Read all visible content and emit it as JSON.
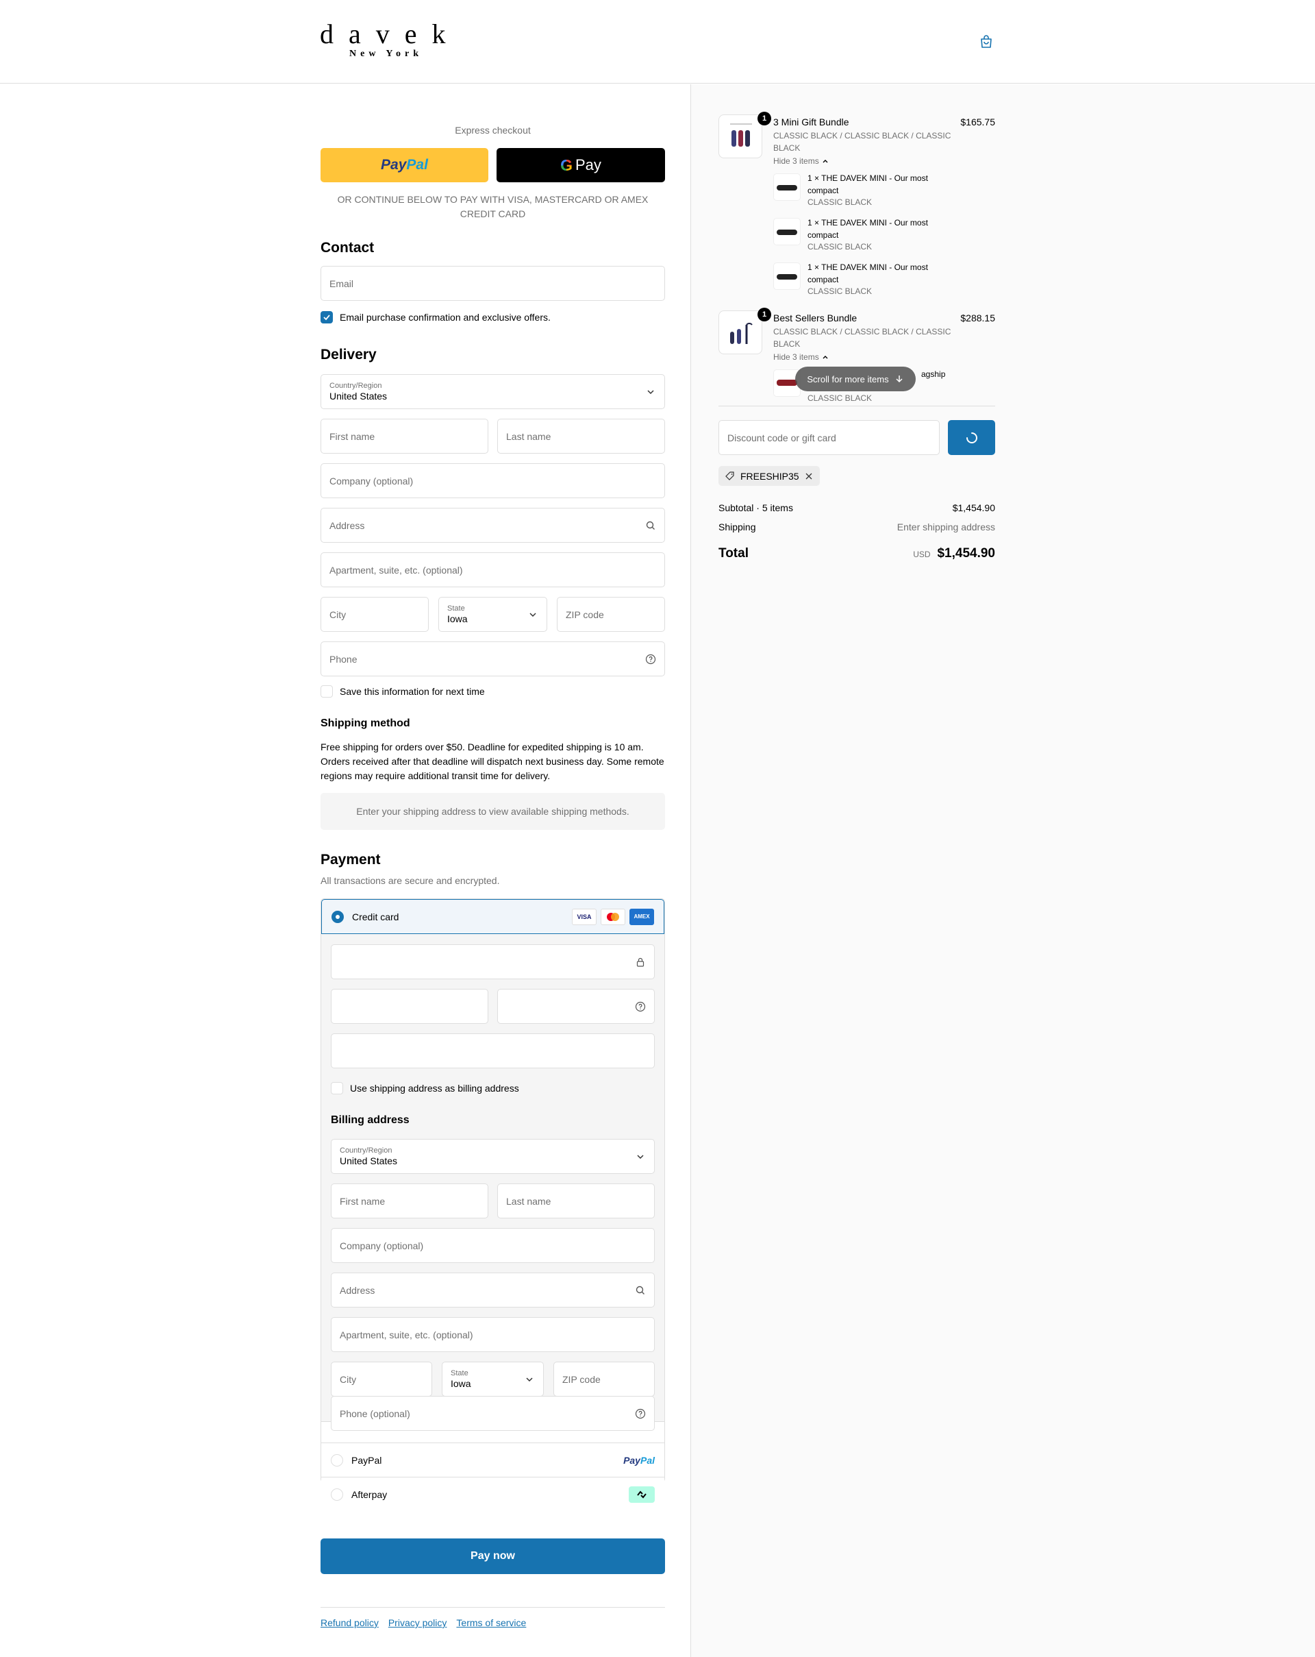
{
  "brand": {
    "logo_main": "davek",
    "logo_sub": "New York"
  },
  "express": {
    "title": "Express checkout",
    "paypal_a": "Pay",
    "paypal_b": "Pal",
    "gpay_g": "G",
    "gpay_label": "Pay",
    "or_text": "OR CONTINUE BELOW TO PAY WITH VISA, MASTERCARD OR AMEX CREDIT CARD"
  },
  "contact": {
    "heading": "Contact",
    "email_placeholder": "Email",
    "newsletter_label": "Email purchase confirmation and exclusive offers.",
    "newsletter_checked": true
  },
  "delivery": {
    "heading": "Delivery",
    "country_label": "Country/Region",
    "country_value": "United States",
    "first_name": "First name",
    "last_name": "Last name",
    "company": "Company (optional)",
    "address": "Address",
    "apartment": "Apartment, suite, etc. (optional)",
    "city": "City",
    "state_label": "State",
    "state_value": "Iowa",
    "zip": "ZIP code",
    "phone": "Phone",
    "save_info": "Save this information for next time"
  },
  "shipping": {
    "heading": "Shipping method",
    "text": "Free shipping for orders over $50. Deadline for expedited shipping is 10 am. Orders received after that deadline will dispatch next business day. Some remote regions may require additional transit time for delivery.",
    "placeholder": "Enter your shipping address to view available shipping methods."
  },
  "payment": {
    "heading": "Payment",
    "subtext": "All transactions are secure and encrypted.",
    "credit_card": "Credit card",
    "card_brands": [
      "VISA",
      "mastercard",
      "AMEX"
    ],
    "use_shipping": "Use shipping address as billing address",
    "billing_heading": "Billing address",
    "billing": {
      "country_label": "Country/Region",
      "country_value": "United States",
      "first_name": "First name",
      "last_name": "Last name",
      "company": "Company (optional)",
      "address": "Address",
      "apartment": "Apartment, suite, etc. (optional)",
      "city": "City",
      "state_label": "State",
      "state_value": "Iowa",
      "zip": "ZIP code",
      "phone": "Phone (optional)"
    },
    "paypal": "PayPal",
    "paypal_logo_a": "Pay",
    "paypal_logo_b": "Pal",
    "afterpay": "Afterpay",
    "pay_now": "Pay now"
  },
  "footer": {
    "refund": "Refund policy",
    "privacy": "Privacy policy",
    "terms": "Terms of service"
  },
  "cart": {
    "items": [
      {
        "qty": "1",
        "name": "3 Mini Gift Bundle",
        "price": "$165.75",
        "variant": "CLASSIC BLACK / CLASSIC BLACK / CLASSIC BLACK",
        "hide_label": "Hide 3 items",
        "sub_items": [
          {
            "title": "1 × THE DAVEK MINI - Our most compact",
            "variant": "CLASSIC BLACK"
          },
          {
            "title": "1 × THE DAVEK MINI - Our most compact",
            "variant": "CLASSIC BLACK"
          },
          {
            "title": "1 × THE DAVEK MINI - Our most compact",
            "variant": "CLASSIC BLACK"
          }
        ]
      },
      {
        "qty": "1",
        "name": "Best Sellers Bundle",
        "price": "$288.15",
        "variant": "CLASSIC BLACK / CLASSIC BLACK / CLASSIC BLACK",
        "hide_label": "Hide 3 items",
        "sub_items": [
          {
            "title": "agship",
            "variant": "CLASSIC BLACK"
          }
        ]
      }
    ],
    "scroll_hint": "Scroll for more items",
    "discount_placeholder": "Discount code or gift card",
    "applied_code": "FREESHIP35",
    "subtotal_label": "Subtotal · 5 items",
    "subtotal_value": "$1,454.90",
    "shipping_label": "Shipping",
    "shipping_value": "Enter shipping address",
    "total_label": "Total",
    "total_currency": "USD",
    "total_value": "$1,454.90"
  },
  "colors": {
    "accent": "#1773b0",
    "paypal_yellow": "#ffc439",
    "border": "#dedede",
    "sidebar_bg": "#fafafa"
  }
}
